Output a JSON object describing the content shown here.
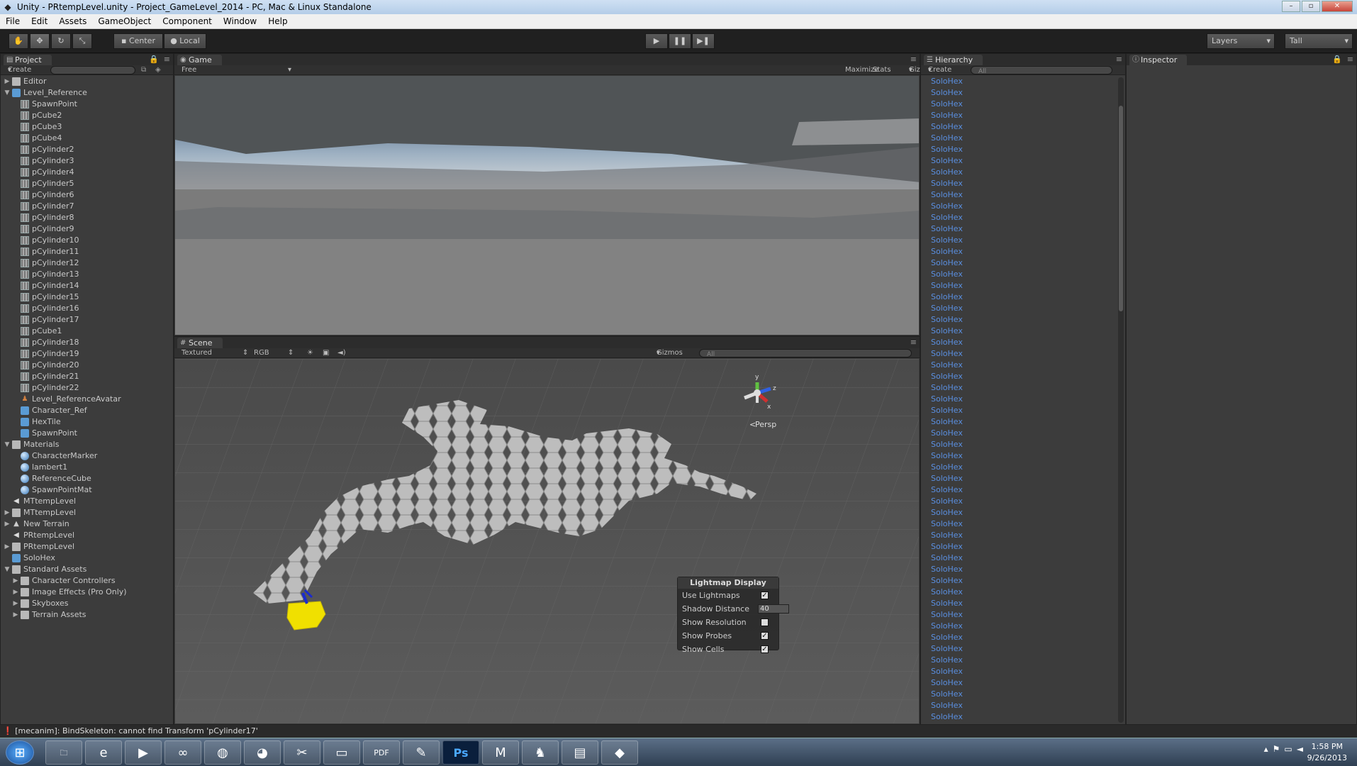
{
  "titlebar": {
    "title": "Unity - PRtempLevel.unity - Project_GameLevel_2014 - PC, Mac & Linux Standalone",
    "app_icon": "unity-icon"
  },
  "menubar": {
    "items": [
      "File",
      "Edit",
      "Assets",
      "GameObject",
      "Component",
      "Window",
      "Help"
    ]
  },
  "toolbar": {
    "tools": [
      "hand-icon",
      "move-icon",
      "rotate-icon",
      "scale-icon"
    ],
    "pivot_label": "Center",
    "space_label": "Local",
    "play_icons": [
      "play-icon",
      "pause-icon",
      "step-icon"
    ],
    "layers_label": "Layers",
    "layout_label": "Tall"
  },
  "project": {
    "tab": "Project",
    "create_label": "Create",
    "items": [
      {
        "label": "Editor",
        "indent": 0,
        "icon": "folder",
        "arrow": "right"
      },
      {
        "label": "Level_Reference",
        "indent": 0,
        "icon": "prefab",
        "arrow": "down"
      },
      {
        "label": "SpawnPoint",
        "indent": 1,
        "icon": "mesh"
      },
      {
        "label": "pCube2",
        "indent": 1,
        "icon": "mesh"
      },
      {
        "label": "pCube3",
        "indent": 1,
        "icon": "mesh"
      },
      {
        "label": "pCube4",
        "indent": 1,
        "icon": "mesh"
      },
      {
        "label": "pCylinder2",
        "indent": 1,
        "icon": "mesh"
      },
      {
        "label": "pCylinder3",
        "indent": 1,
        "icon": "mesh"
      },
      {
        "label": "pCylinder4",
        "indent": 1,
        "icon": "mesh"
      },
      {
        "label": "pCylinder5",
        "indent": 1,
        "icon": "mesh"
      },
      {
        "label": "pCylinder6",
        "indent": 1,
        "icon": "mesh"
      },
      {
        "label": "pCylinder7",
        "indent": 1,
        "icon": "mesh"
      },
      {
        "label": "pCylinder8",
        "indent": 1,
        "icon": "mesh"
      },
      {
        "label": "pCylinder9",
        "indent": 1,
        "icon": "mesh"
      },
      {
        "label": "pCylinder10",
        "indent": 1,
        "icon": "mesh"
      },
      {
        "label": "pCylinder11",
        "indent": 1,
        "icon": "mesh"
      },
      {
        "label": "pCylinder12",
        "indent": 1,
        "icon": "mesh"
      },
      {
        "label": "pCylinder13",
        "indent": 1,
        "icon": "mesh"
      },
      {
        "label": "pCylinder14",
        "indent": 1,
        "icon": "mesh"
      },
      {
        "label": "pCylinder15",
        "indent": 1,
        "icon": "mesh"
      },
      {
        "label": "pCylinder16",
        "indent": 1,
        "icon": "mesh"
      },
      {
        "label": "pCylinder17",
        "indent": 1,
        "icon": "mesh"
      },
      {
        "label": "pCube1",
        "indent": 1,
        "icon": "mesh"
      },
      {
        "label": "pCylinder18",
        "indent": 1,
        "icon": "mesh"
      },
      {
        "label": "pCylinder19",
        "indent": 1,
        "icon": "mesh"
      },
      {
        "label": "pCylinder20",
        "indent": 1,
        "icon": "mesh"
      },
      {
        "label": "pCylinder21",
        "indent": 1,
        "icon": "mesh"
      },
      {
        "label": "pCylinder22",
        "indent": 1,
        "icon": "mesh"
      },
      {
        "label": "Level_ReferenceAvatar",
        "indent": 1,
        "icon": "avatar"
      },
      {
        "label": "Character_Ref",
        "indent": 1,
        "icon": "prefab"
      },
      {
        "label": "HexTile",
        "indent": 1,
        "icon": "prefab"
      },
      {
        "label": "SpawnPoint",
        "indent": 1,
        "icon": "prefab"
      },
      {
        "label": "Materials",
        "indent": 0,
        "icon": "folder",
        "arrow": "down"
      },
      {
        "label": "CharacterMarker",
        "indent": 1,
        "icon": "mat"
      },
      {
        "label": "lambert1",
        "indent": 1,
        "icon": "mat"
      },
      {
        "label": "ReferenceCube",
        "indent": 1,
        "icon": "mat"
      },
      {
        "label": "SpawnPointMat",
        "indent": 1,
        "icon": "mat"
      },
      {
        "label": "MTtempLevel",
        "indent": 0,
        "icon": "scene"
      },
      {
        "label": "MTtempLevel",
        "indent": 0,
        "icon": "folder",
        "arrow": "right"
      },
      {
        "label": "New Terrain",
        "indent": 0,
        "icon": "terrain",
        "arrow": "right"
      },
      {
        "label": "PRtempLevel",
        "indent": 0,
        "icon": "scene"
      },
      {
        "label": "PRtempLevel",
        "indent": 0,
        "icon": "folder",
        "arrow": "right"
      },
      {
        "label": "SoloHex",
        "indent": 0,
        "icon": "prefab"
      },
      {
        "label": "Standard Assets",
        "indent": 0,
        "icon": "folder",
        "arrow": "down"
      },
      {
        "label": "Character Controllers",
        "indent": 1,
        "icon": "folder",
        "arrow": "right"
      },
      {
        "label": "Image Effects (Pro Only)",
        "indent": 1,
        "icon": "folder",
        "arrow": "right"
      },
      {
        "label": "Skyboxes",
        "indent": 1,
        "icon": "folder",
        "arrow": "right"
      },
      {
        "label": "Terrain Assets",
        "indent": 1,
        "icon": "folder",
        "arrow": "right"
      }
    ]
  },
  "game": {
    "tab": "Game",
    "aspect": "Free Aspect",
    "maximize_label": "Maximize on Play",
    "stats_label": "Stats",
    "gizmos_label": "Gizmos"
  },
  "scene": {
    "tab": "Scene",
    "render_mode": "Textured",
    "color_mode": "RGB",
    "gizmos_label": "Gizmos",
    "search_placeholder": "All",
    "persp_label": "Persp",
    "axis_labels": {
      "y": "y",
      "z": "z",
      "x": "x"
    }
  },
  "lightmap": {
    "title": "Lightmap Display",
    "use_lightmaps": "Use Lightmaps",
    "shadow_distance": "Shadow Distance",
    "shadow_distance_value": "40",
    "show_resolution": "Show Resolution",
    "show_probes": "Show Probes",
    "show_cells": "Show Cells",
    "checked": {
      "use_lightmaps": true,
      "show_resolution": false,
      "show_probes": true,
      "show_cells": true
    },
    "check_glyph": "✓"
  },
  "hierarchy": {
    "tab": "Hierarchy",
    "create_label": "Create",
    "search_placeholder": "All",
    "item_label": "SoloHex",
    "count": 57
  },
  "inspector": {
    "tab": "Inspector"
  },
  "status": {
    "message": "[mecanim]: BindSkeleton: cannot find Transform 'pCylinder17'"
  },
  "taskbar": {
    "apps": [
      "windows-start-icon",
      "file-explorer-icon",
      "internet-explorer-icon",
      "media-player-icon",
      "infinity-app-icon",
      "chrome-icon",
      "messenger-icon",
      "snipping-tool-icon",
      "window-app-icon",
      "pdf-icon",
      "paint-app-icon",
      "photoshop-icon",
      "maya-icon",
      "zbrush-icon",
      "winrar-icon",
      "unity-icon"
    ],
    "photoshop_label": "Ps",
    "time": "1:58 PM",
    "date": "9/26/2013"
  }
}
